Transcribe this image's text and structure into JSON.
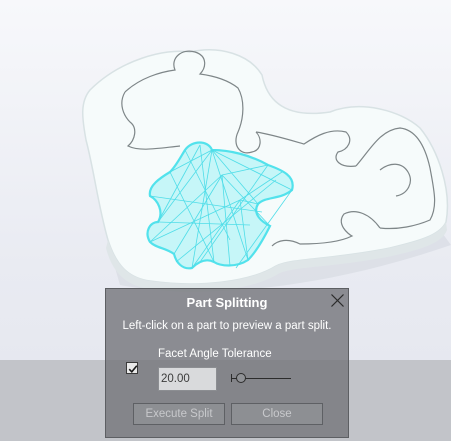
{
  "dialog": {
    "title": "Part Splitting",
    "instruction": "Left-click on a part to preview a part split.",
    "facet_label": "Facet Angle Tolerance",
    "facet_value": "20.00",
    "checkbox_checked": true,
    "slider_level": 0.17,
    "execute_label": "Execute Split",
    "close_label": "Close"
  },
  "colors": {
    "dialog_bg": "#76787c",
    "highlight": "#5fe6ee",
    "model": "#ffffff"
  },
  "icons": {
    "close": "close-icon",
    "check": "checkmark-icon"
  }
}
